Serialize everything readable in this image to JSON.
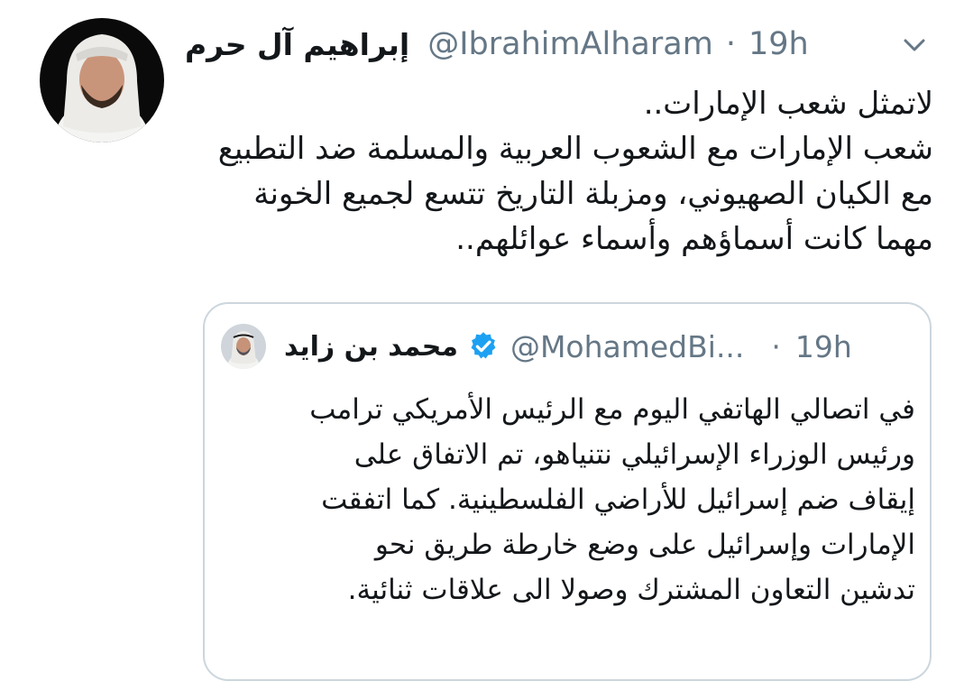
{
  "tweet": {
    "author_name": "إبراهيم آل حرم",
    "handle": "@IbrahimAlharam",
    "separator": "·",
    "time": "19h",
    "lines": [
      "لاتمثل شعب الإمارات..",
      "شعب الإمارات مع الشعوب العربية والمسلمة ضد التطبيع",
      "مع الكيان الصهيوني، ومزبلة التاريخ تتسع لجميع الخونة",
      "مهما كانت أسماؤهم وأسماء عوائلهم.."
    ]
  },
  "quoted_tweet": {
    "author_name": "محمد بن زايد",
    "handle": "@MohamedBi...",
    "separator": "·",
    "time": "19h",
    "verified": true,
    "lines": [
      "في اتصالي الهاتفي اليوم مع الرئيس الأمريكي ترامب",
      "ورئيس الوزراء الإسرائيلي نتنياهو، تم الاتفاق على",
      "إيقاف ضم إسرائيل للأراضي الفلسطينية. كما اتفقت",
      "الإمارات وإسرائيل على وضع خارطة طريق نحو",
      "تدشين التعاون المشترك وصولا الى علاقات ثنائية."
    ]
  },
  "icons": {
    "menu": "chevron-down-icon",
    "verified": "verified-badge-icon"
  },
  "colors": {
    "text": "#14171a",
    "secondary": "#657786",
    "verified": "#1da1f2",
    "border": "#ccd6dd"
  }
}
